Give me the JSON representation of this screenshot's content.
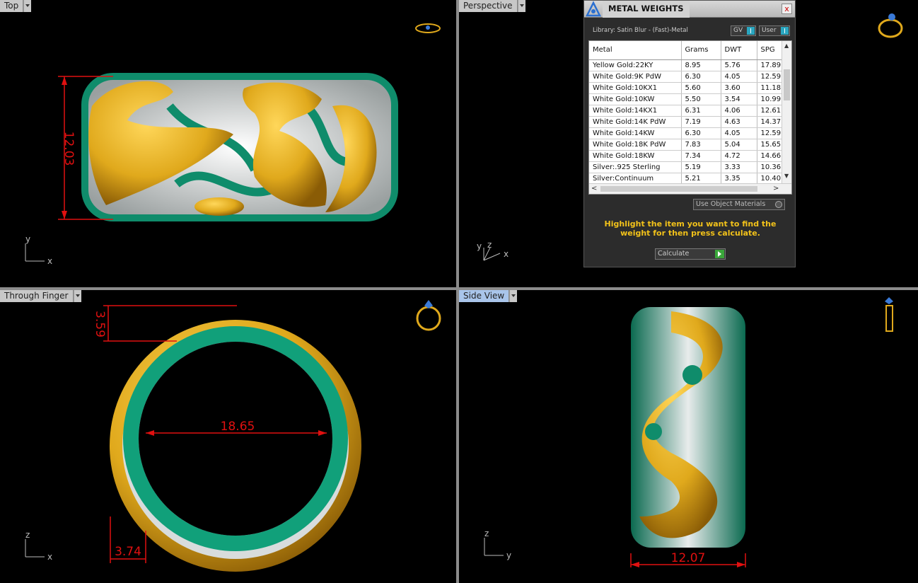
{
  "viewports": {
    "top": {
      "label": "Top",
      "dimension": "12.03"
    },
    "perspective": {
      "label": "Perspective"
    },
    "through_finger": {
      "label": "Through Finger",
      "dim_height": "3.59",
      "dim_inner": "18.65",
      "dim_wall": "3.74"
    },
    "side": {
      "label": "Side View",
      "dimension": "12.07"
    }
  },
  "axes": {
    "x": "x",
    "y": "y",
    "z": "z"
  },
  "metal_panel": {
    "title": "METAL WEIGHTS",
    "close": "x",
    "library": "Library: Satin Blur - (Fast)-Metal",
    "toggle_gv": "GV",
    "toggle_user": "User",
    "columns": [
      "Metal",
      "Grams",
      "DWT",
      "SPG"
    ],
    "rows": [
      [
        "Yellow Gold:22KY",
        "8.95",
        "5.76",
        "17.89"
      ],
      [
        "White Gold:9K PdW",
        "6.30",
        "4.05",
        "12.59"
      ],
      [
        "White Gold:10KX1",
        "5.60",
        "3.60",
        "11.18"
      ],
      [
        "White Gold:10KW",
        "5.50",
        "3.54",
        "10.99"
      ],
      [
        "White Gold:14KX1",
        "6.31",
        "4.06",
        "12.61"
      ],
      [
        "White Gold:14K PdW",
        "7.19",
        "4.63",
        "14.37"
      ],
      [
        "White Gold:14KW",
        "6.30",
        "4.05",
        "12.59"
      ],
      [
        "White Gold:18K PdW",
        "7.83",
        "5.04",
        "15.65"
      ],
      [
        "White Gold:18KW",
        "7.34",
        "4.72",
        "14.66"
      ],
      [
        "Silver:.925 Sterling",
        "5.19",
        "3.33",
        "10.36"
      ],
      [
        "Silver:Continuum",
        "5.21",
        "3.35",
        "10.40"
      ]
    ],
    "use_object_materials": "Use Object Materials",
    "hint": "Highlight the item you want to find the weight for then press calculate.",
    "calculate": "Calculate"
  },
  "colors": {
    "gold": "#e0a91c",
    "green": "#0f8c6b",
    "dimension": "#e01010",
    "viewport_bg": "#000000",
    "hint": "#f2c21a"
  }
}
